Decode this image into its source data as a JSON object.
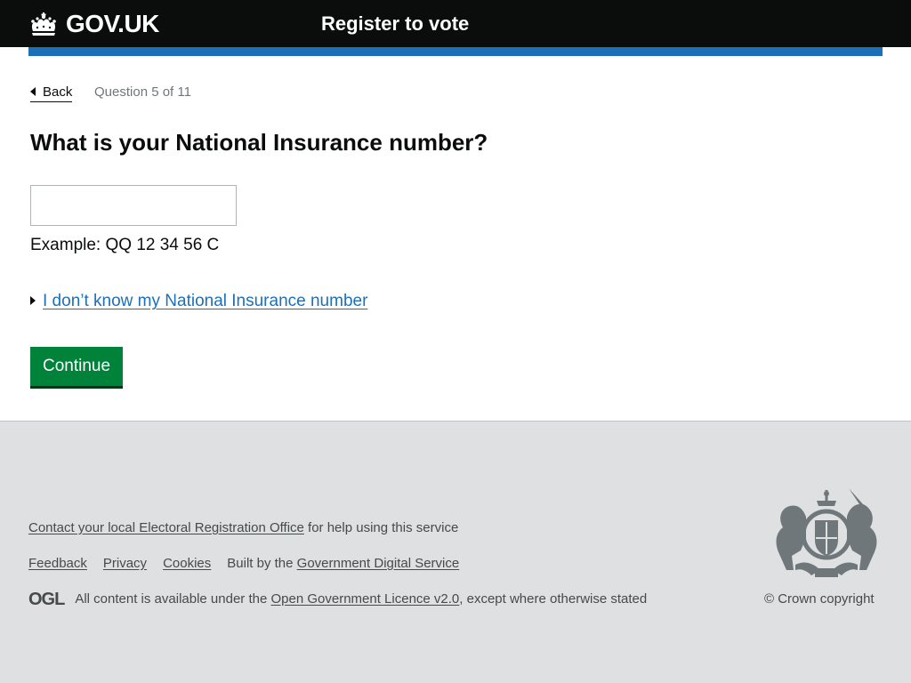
{
  "header": {
    "logo_text": "GOV.UK",
    "service_name": "Register to vote"
  },
  "nav": {
    "back_label": "Back",
    "progress_text": "Question 5 of 11"
  },
  "question": {
    "title": "What is your National Insurance number?",
    "input_value": "",
    "hint": "Example: QQ 12 34 56 C",
    "details_label": "I don’t know my National Insurance number",
    "continue_label": "Continue"
  },
  "footer": {
    "contact_link": "Contact your local Electoral Registration Office",
    "contact_suffix": " for help using this service",
    "links": [
      "Feedback",
      "Privacy",
      "Cookies"
    ],
    "built_by_prefix": "Built by the ",
    "built_by_link": "Government Digital Service",
    "ogl_logo_text": "OGL",
    "licence_prefix": "All content is available under the ",
    "licence_link": "Open Government Licence v2.0",
    "licence_suffix": ", except where otherwise stated",
    "copyright": "© Crown copyright"
  },
  "colors": {
    "header_bg": "#0b0c0c",
    "accent_blue": "#1d70b8",
    "button_green": "#00823b",
    "footer_bg": "#dee0e2"
  },
  "icons": {
    "logo": "crown-icon",
    "back": "triangle-left-icon",
    "details": "triangle-right-icon",
    "footer_crest": "royal-coat-of-arms-icon"
  }
}
